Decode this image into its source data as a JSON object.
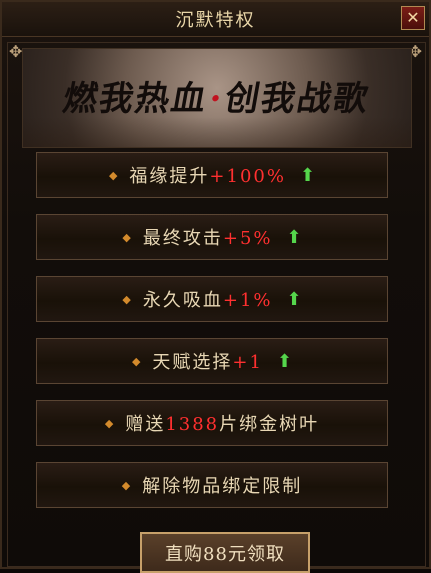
{
  "window": {
    "title": "沉默特权"
  },
  "banner": {
    "slogan_left": "燃我热血",
    "separator": "·",
    "slogan_right": "创我战歌"
  },
  "benefits": [
    {
      "label": "福缘提升",
      "value": "+100%"
    },
    {
      "label": "最终攻击",
      "value": "+5%"
    },
    {
      "label": "永久吸血",
      "value": "+1%"
    },
    {
      "label": "天赋选择",
      "value": "+1"
    }
  ],
  "gift": {
    "prefix": "赠送",
    "amount": "1388",
    "suffix": "片绑金树叶"
  },
  "unbind": {
    "label": "解除物品绑定限制"
  },
  "buy_button": {
    "label": "直购88元领取"
  },
  "icons": {
    "close": "close-icon",
    "up_arrow": "up-arrow-icon",
    "bullet": "diamond-bullet-icon",
    "corner": "corner-ornament-icon"
  },
  "colors": {
    "highlight_red": "#ff3030",
    "bonus_green": "#55d64c",
    "text_gold": "#e8d7b4"
  }
}
